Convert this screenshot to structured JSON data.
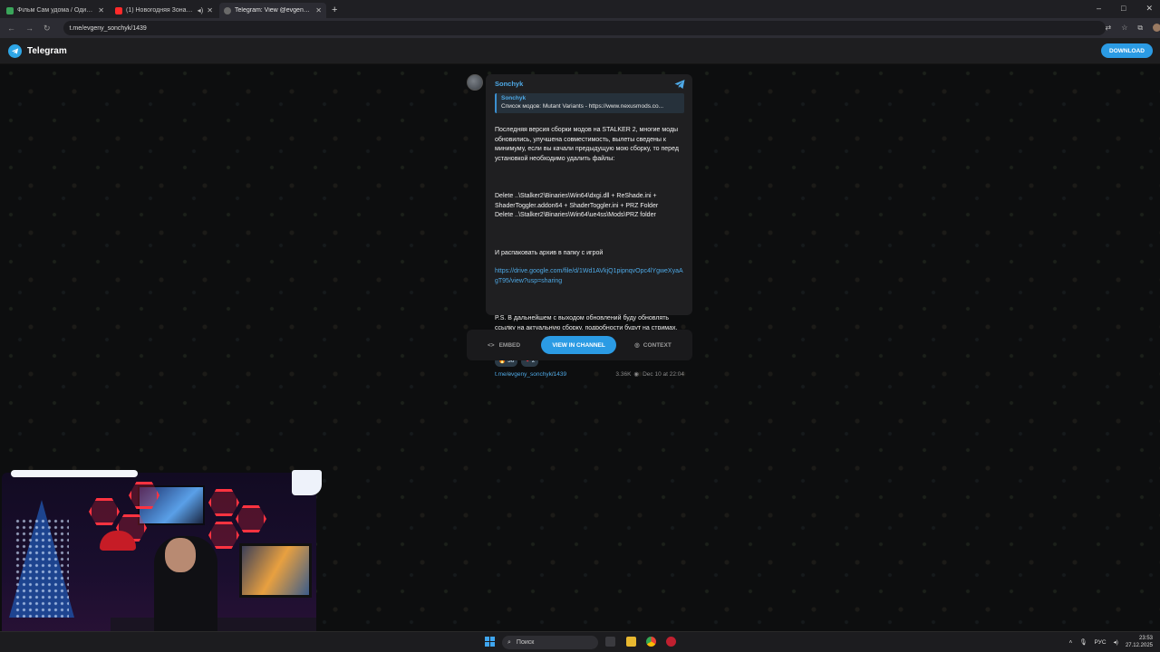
{
  "browser": {
    "tabs": [
      {
        "title": "Фільм Сам удома / Один вдо...",
        "color": "#3aa55a"
      },
      {
        "title": "(1) Новогодняя Зона в S.T...",
        "color": "#ff2a2a"
      },
      {
        "title": "Telegram: View @evgeny_sonc...",
        "color": "#6a6a6a"
      }
    ],
    "new_tab": "+",
    "url": "t.me/evgeny_sonchyk/1439",
    "window_controls": [
      "–",
      "□",
      "✕"
    ]
  },
  "telegram": {
    "brand": "Telegram",
    "download": "DOWNLOAD"
  },
  "message": {
    "channel": "Sonchyk",
    "reply_name": "Sonchyk",
    "reply_text": "Список модов: Mutant Variants - https://www.nexusmods.co...",
    "para1": "Последняя версия сборки модов на STALKER 2, многие моды обновились, улучшена совместимость, вылеты сведены к минимуму, если вы качали предыдущую мою сборку, то перед установкой необходимо удалить файлы:",
    "para2": "Delete ..\\Stalker2\\Binaries\\Win64\\dxgi.dll + ReShade.ini + ShaderToggler.addon64 + ShaderToggler.ini + PRZ Folder\nDelete ..\\Stalker2\\Binaries\\Win64\\ue4ss\\Mods\\PRZ folder",
    "para3": "И распаковать архив в папку с игрой",
    "link": "https://drive.google.com/file/d/1Wd1AVkjQ1pipnqvOpc4lYgweXyaAgT95/view?usp=sharing",
    "para4": "P.S. В дальнейшем с выходом обновлений буду обновлять ссылку на актуальную сборку, подробности будут на стримах, так что не пропускайте! Приятной игры!",
    "reactions": [
      {
        "emoji": "🔥",
        "count": "36"
      },
      {
        "emoji": "❤",
        "count": "2"
      }
    ],
    "post_link": "t.me/evgeny_sonchyk/1439",
    "views": "3.36K",
    "date": "Dec 10 at 22:04"
  },
  "actions": {
    "embed": "EMBED",
    "view_in_channel": "VIEW IN CHANNEL",
    "context": "CONTEXT"
  },
  "taskbar": {
    "search_placeholder": "Поиск",
    "lang": "РУС",
    "time": "23:53",
    "date": "27.12.2025"
  }
}
